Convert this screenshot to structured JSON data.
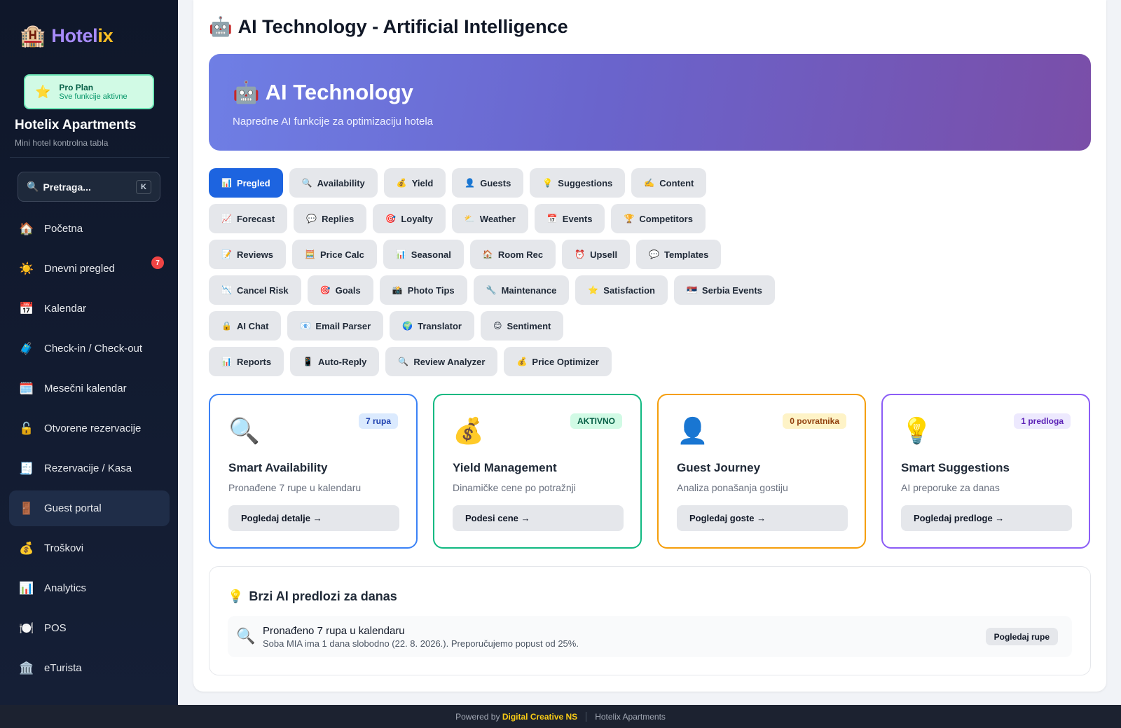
{
  "sidebar": {
    "logo": {
      "text_main": "Hotel",
      "text_accent": "ix",
      "icon": "hotel-icon"
    },
    "plan": {
      "title": "Pro Plan",
      "subtitle": "Sve funkcije aktivne"
    },
    "hotel_name": "Hotelix Apartments",
    "hotel_subtitle": "Mini hotel kontrolna tabla",
    "search": {
      "label": "Pretraga...",
      "shortcut": "K"
    },
    "nav": [
      {
        "icon": "🏠",
        "label": "Početna"
      },
      {
        "icon": "☀️",
        "label": "Dnevni pregled",
        "badge": "7"
      },
      {
        "icon": "📅",
        "label": "Kalendar"
      },
      {
        "icon": "🧳",
        "label": "Check-in / Check-out"
      },
      {
        "icon": "🗓️",
        "label": "Mesečni kalendar"
      },
      {
        "icon": "🔓",
        "label": "Otvorene rezervacije"
      },
      {
        "icon": "🧾",
        "label": "Rezervacije / Kasa"
      },
      {
        "icon": "🚪",
        "label": "Guest portal",
        "active": true
      },
      {
        "icon": "💰",
        "label": "Troškovi"
      },
      {
        "icon": "📊",
        "label": "Analytics"
      },
      {
        "icon": "🍽️",
        "label": "POS"
      },
      {
        "icon": "🏛️",
        "label": "eTurista"
      }
    ]
  },
  "page": {
    "title": "AI Technology - Artificial Intelligence",
    "title_icon": "🤖"
  },
  "hero": {
    "icon": "🤖",
    "title": "AI Technology",
    "subtitle": "Napredne AI funkcije za optimizaciju hotela"
  },
  "tabs": [
    [
      {
        "icon": "📊",
        "label": "Pregled",
        "active": true
      },
      {
        "icon": "🔍",
        "label": "Availability"
      },
      {
        "icon": "💰",
        "label": "Yield"
      },
      {
        "icon": "👤",
        "label": "Guests"
      },
      {
        "icon": "💡",
        "label": "Suggestions"
      },
      {
        "icon": "✍️",
        "label": "Content"
      }
    ],
    [
      {
        "icon": "📈",
        "label": "Forecast"
      },
      {
        "icon": "💬",
        "label": "Replies"
      },
      {
        "icon": "🎯",
        "label": "Loyalty"
      },
      {
        "icon": "⛅",
        "label": "Weather"
      },
      {
        "icon": "📅",
        "label": "Events"
      },
      {
        "icon": "🏆",
        "label": "Competitors"
      }
    ],
    [
      {
        "icon": "📝",
        "label": "Reviews"
      },
      {
        "icon": "🧮",
        "label": "Price Calc"
      },
      {
        "icon": "📊",
        "label": "Seasonal"
      },
      {
        "icon": "🏠",
        "label": "Room Rec"
      },
      {
        "icon": "⏰",
        "label": "Upsell"
      },
      {
        "icon": "💬",
        "label": "Templates"
      }
    ],
    [
      {
        "icon": "📉",
        "label": "Cancel Risk"
      },
      {
        "icon": "🎯",
        "label": "Goals"
      },
      {
        "icon": "📸",
        "label": "Photo Tips"
      },
      {
        "icon": "🔧",
        "label": "Maintenance"
      },
      {
        "icon": "⭐",
        "label": "Satisfaction"
      },
      {
        "icon": "🇷🇸",
        "label": "Serbia Events"
      }
    ],
    [
      {
        "icon": "🔒",
        "label": "AI Chat"
      },
      {
        "icon": "📧",
        "label": "Email Parser"
      },
      {
        "icon": "🌍",
        "label": "Translator"
      },
      {
        "icon": "😊",
        "label": "Sentiment"
      }
    ],
    [
      {
        "icon": "📊",
        "label": "Reports"
      },
      {
        "icon": "📱",
        "label": "Auto-Reply"
      },
      {
        "icon": "🔍",
        "label": "Review Analyzer"
      },
      {
        "icon": "💰",
        "label": "Price Optimizer"
      }
    ]
  ],
  "cards": [
    {
      "icon": "🔍",
      "badge": "7 rupa",
      "title": "Smart Availability",
      "desc": "Pronađene 7 rupe u kalendaru",
      "button": "Pogledaj detalje →",
      "color": "#3b82f6",
      "badge_bg": "#dbeafe",
      "badge_fg": "#1e40af"
    },
    {
      "icon": "💰",
      "badge": "AKTIVNO",
      "title": "Yield Management",
      "desc": "Dinamičke cene po potražnji",
      "button": "Podesi cene →",
      "color": "#10b981",
      "badge_bg": "#d1fae5",
      "badge_fg": "#065f46"
    },
    {
      "icon": "👤",
      "badge": "0 povratnika",
      "title": "Guest Journey",
      "desc": "Analiza ponašanja gostiju",
      "button": "Pogledaj goste →",
      "color": "#f59e0b",
      "badge_bg": "#fef3c7",
      "badge_fg": "#92400e"
    },
    {
      "icon": "💡",
      "badge": "1 predloga",
      "title": "Smart Suggestions",
      "desc": "AI preporuke za danas",
      "button": "Pogledaj predloge →",
      "color": "#8b5cf6",
      "badge_bg": "#ede9fe",
      "badge_fg": "#5b21b6"
    }
  ],
  "suggestions": {
    "icon": "💡",
    "title": "Brzi AI predlozi za danas",
    "items": [
      {
        "icon": "🔍",
        "title": "Pronađeno 7 rupa u kalendaru",
        "desc": "Soba MIA ima 1 dana slobodno (22. 8. 2026.). Preporučujemo popust od 25%.",
        "button": "Pogledaj rupe"
      }
    ]
  },
  "footer": {
    "powered_by": "Powered by",
    "brand": "Digital Creative NS",
    "hotel": "Hotelix Apartments"
  }
}
